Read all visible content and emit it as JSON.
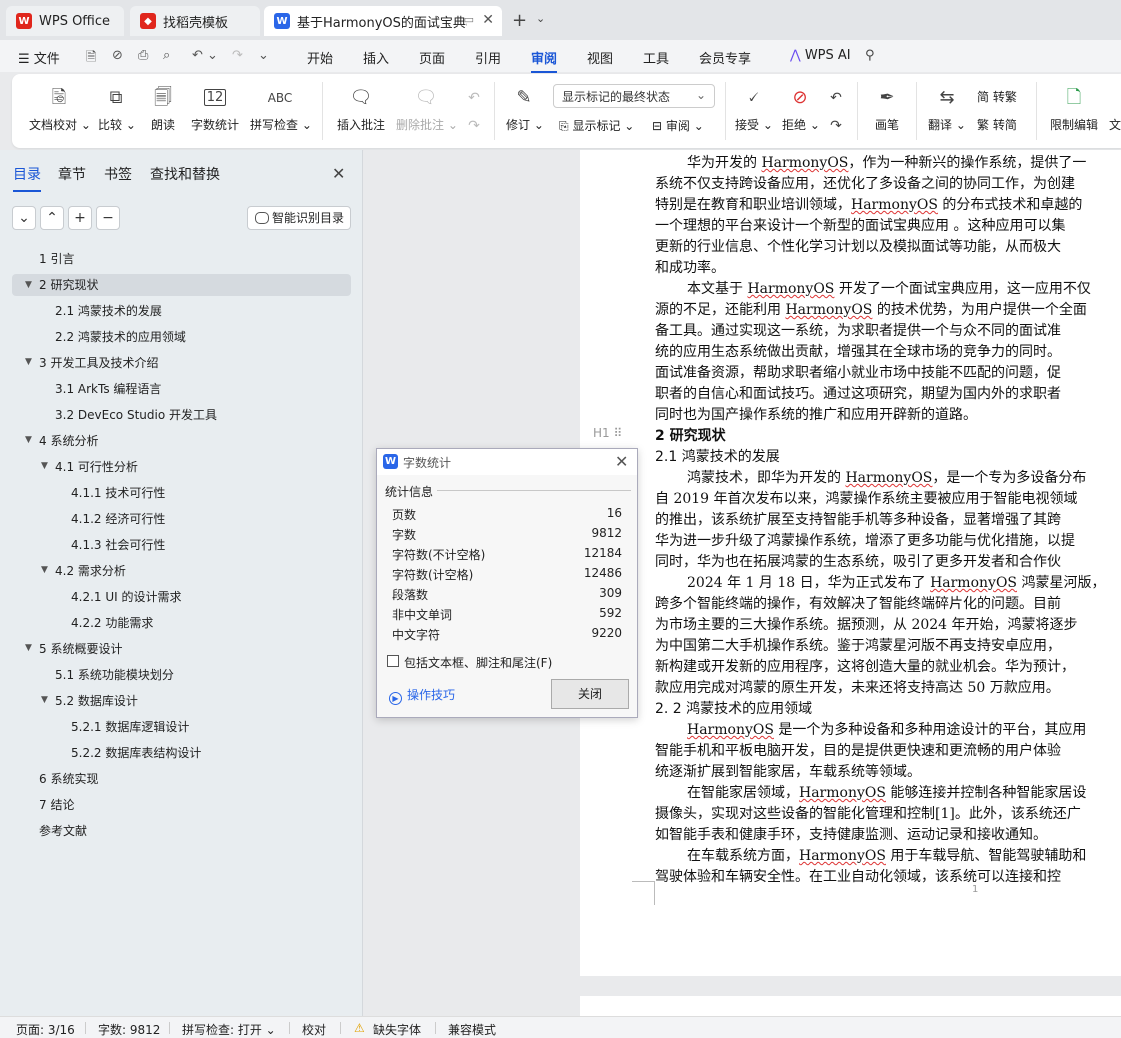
{
  "tabs": [
    {
      "label": "WPS Office"
    },
    {
      "label": "找稻壳模板"
    },
    {
      "label": "基于HarmonyOS的面试宝典a"
    }
  ],
  "menu": {
    "file": "文件",
    "items": [
      "开始",
      "插入",
      "页面",
      "引用",
      "审阅",
      "视图",
      "工具",
      "会员专享"
    ],
    "wps_ai": "WPS AI"
  },
  "ribbon": {
    "proofread": "文档校对",
    "compare": "比较",
    "read_aloud": "朗读",
    "word_count": "字数统计",
    "spell_check": "拼写检查",
    "spell_icon_text": "ABC",
    "wc_icon_text": "12",
    "insert_comment": "插入批注",
    "delete_comment": "删除批注",
    "revise": "修订",
    "markup_mode": "显示标记的最终状态",
    "show_markup": "显示标记",
    "review": "审阅",
    "accept": "接受",
    "reject": "拒绝",
    "pen": "画笔",
    "translate": "翻译",
    "to_trad": "转繁",
    "to_simp": "转简",
    "restrict_edit": "限制编辑",
    "cut_label": "文"
  },
  "left_panel": {
    "tabs": [
      "目录",
      "章节",
      "书签",
      "查找和替换"
    ],
    "smart_toc": "智能识别目录",
    "toc": [
      {
        "label": "1  引言"
      },
      {
        "label": "2  研究现状"
      },
      {
        "label": "2.1  鸿蒙技术的发展"
      },
      {
        "label": "2.2 鸿蒙技术的应用领域"
      },
      {
        "label": "3  开发工具及技术介绍"
      },
      {
        "label": "3.1 ArkTs 编程语言"
      },
      {
        "label": "3.2 DevEco Studio 开发工具"
      },
      {
        "label": "4  系统分析"
      },
      {
        "label": "4.1  可行性分析"
      },
      {
        "label": "4.1.1  技术可行性"
      },
      {
        "label": "4.1.2  经济可行性"
      },
      {
        "label": "4.1.3  社会可行性"
      },
      {
        "label": "4.2  需求分析"
      },
      {
        "label": "4.2.1 UI 的设计需求"
      },
      {
        "label": "4.2.2  功能需求"
      },
      {
        "label": "5  系统概要设计"
      },
      {
        "label": "5.1  系统功能模块划分"
      },
      {
        "label": "5.2 数据库设计"
      },
      {
        "label": "5.2.1 数据库逻辑设计"
      },
      {
        "label": "5.2.2  数据库表结构设计"
      },
      {
        "label": "6  系统实现"
      },
      {
        "label": "7  结论"
      },
      {
        "label": "参考文献"
      }
    ]
  },
  "document": {
    "lines": [
      {
        "pre": "华为开发的 ",
        "hw": "HarmonyOS",
        "post": "，作为一种新兴的操作系统，提供了一"
      },
      {
        "pre": "系统不仅支持跨设备应用，还优化了多设备之间的协同工作，为创建",
        "hw": "",
        "post": ""
      },
      {
        "pre": "特别是在教育和职业培训领域，",
        "hw": "HarmonyOS",
        "post": " 的分布式技术和卓越的"
      },
      {
        "pre": "一个理想的平台来设计一个新型的面试宝典应用 。这种应用可以集",
        "hw": "",
        "post": ""
      },
      {
        "pre": "更新的行业信息、个性化学习计划以及模拟面试等功能，从而极大",
        "hw": "",
        "post": ""
      },
      {
        "pre": "和成功率。",
        "hw": "",
        "post": ""
      },
      {
        "pre": "本文基于 ",
        "hw": "HarmonyOS",
        "post": " 开发了一个面试宝典应用，这一应用不仅"
      },
      {
        "pre": "源的不足，还能利用 ",
        "hw": "HarmonyOS",
        "post": " 的技术优势，为用户提供一个全面"
      },
      {
        "pre": "备工具。通过实现这一系统，为求职者提供一个与众不同的面试准",
        "hw": "",
        "post": ""
      },
      {
        "pre": "统的应用生态系统做出贡献，增强其在全球市场的竞争力的同时。",
        "hw": "",
        "post": ""
      },
      {
        "pre": "面试准备资源，帮助求职者缩小就业市场中技能不匹配的问题，促",
        "hw": "",
        "post": ""
      },
      {
        "pre": "职者的自信心和面试技巧。通过这项研究，期望为国内外的求职者",
        "hw": "",
        "post": ""
      },
      {
        "pre": "同时也为国产操作系统的推广和应用开辟新的道路。",
        "hw": "",
        "post": ""
      },
      {
        "pre": "2  研究现状",
        "hw": "",
        "post": ""
      },
      {
        "pre": "2.1  鸿蒙技术的发展",
        "hw": "",
        "post": ""
      },
      {
        "pre": "鸿蒙技术，即华为开发的 ",
        "hw": "HarmonyOS",
        "post": "，是一个专为多设备分布"
      },
      {
        "pre": "自 2019 年首次发布以来，鸿蒙操作系统主要被应用于智能电视领域",
        "hw": "",
        "post": ""
      },
      {
        "pre": "的推出，该系统扩展至支持智能手机等多种设备，显著增强了其跨",
        "hw": "",
        "post": ""
      },
      {
        "pre": "华为进一步升级了鸿蒙操作系统，增添了更多功能与优化措施，以提",
        "hw": "",
        "post": ""
      },
      {
        "pre": "同时，华为也在拓展鸿蒙的生态系统，吸引了更多开发者和合作伙",
        "hw": "",
        "post": ""
      },
      {
        "pre": "2024 年 1 月 18 日，华为正式发布了 ",
        "hw": "HarmonyOS",
        "post": " 鸿蒙星河版，"
      },
      {
        "pre": "跨多个智能终端的操作，有效解决了智能终端碎片化的问题。目前",
        "hw": "",
        "post": ""
      },
      {
        "pre": "为市场主要的三大操作系统。据预测，从 2024 年开始，鸿蒙将逐步",
        "hw": "",
        "post": ""
      },
      {
        "pre": "为中国第二大手机操作系统。鉴于鸿蒙星河版不再支持安卓应用，",
        "hw": "",
        "post": ""
      },
      {
        "pre": "新构建或开发新的应用程序，这将创造大量的就业机会。华为预计，",
        "hw": "",
        "post": ""
      },
      {
        "pre": "款应用完成对鸿蒙的原生开发，未来还将支持高达 50 万款应用。",
        "hw": "",
        "post": ""
      },
      {
        "pre": "2. 2 鸿蒙技术的应用领域",
        "hw": "",
        "post": ""
      },
      {
        "pre": "",
        "hw": "HarmonyOS",
        "post": " 是一个为多种设备和多种用途设计的平台，其应用"
      },
      {
        "pre": "智能手机和平板电脑开发，目的是提供更快速和更流畅的用户体验",
        "hw": "",
        "post": ""
      },
      {
        "pre": "统逐渐扩展到智能家居，车载系统等领域。",
        "hw": "",
        "post": ""
      },
      {
        "pre": "在智能家居领域，",
        "hw": "HarmonyOS",
        "post": " 能够连接并控制各种智能家居设"
      },
      {
        "pre": "摄像头，实现对这些设备的智能化管理和控制[1]。此外，该系统还广",
        "hw": "",
        "post": ""
      },
      {
        "pre": "如智能手表和健康手环，支持健康监测、运动记录和接收通知。",
        "hw": "",
        "post": ""
      },
      {
        "pre": "在车载系统方面，",
        "hw": "HarmonyOS",
        "post": " 用于车载导航、智能驾驶辅助和"
      },
      {
        "pre": "驾驶体验和车辆安全性。在工业自动化领域，该系统可以连接和控",
        "hw": "",
        "post": ""
      }
    ],
    "page_number": "1",
    "heading_marker": "H1"
  },
  "dialog": {
    "title": "字数统计",
    "group": "统计信息",
    "stats": [
      {
        "label": "页数",
        "value": "16"
      },
      {
        "label": "字数",
        "value": "9812"
      },
      {
        "label": "字符数(不计空格)",
        "value": "12184"
      },
      {
        "label": "字符数(计空格)",
        "value": "12486"
      },
      {
        "label": "段落数",
        "value": "309"
      },
      {
        "label": "非中文单词",
        "value": "592"
      },
      {
        "label": "中文字符",
        "value": "9220"
      }
    ],
    "checkbox": "包括文本框、脚注和尾注(F)",
    "tips": "操作技巧",
    "close": "关闭"
  },
  "status": {
    "page": "页面: 3/16",
    "words": "字数: 9812",
    "spell": "拼写检查: 打开",
    "proof": "校对",
    "missing_font": "缺失字体",
    "compat": "兼容模式"
  },
  "colors": {
    "accent": "#1a56d6",
    "wps_red": "#e0261c"
  }
}
